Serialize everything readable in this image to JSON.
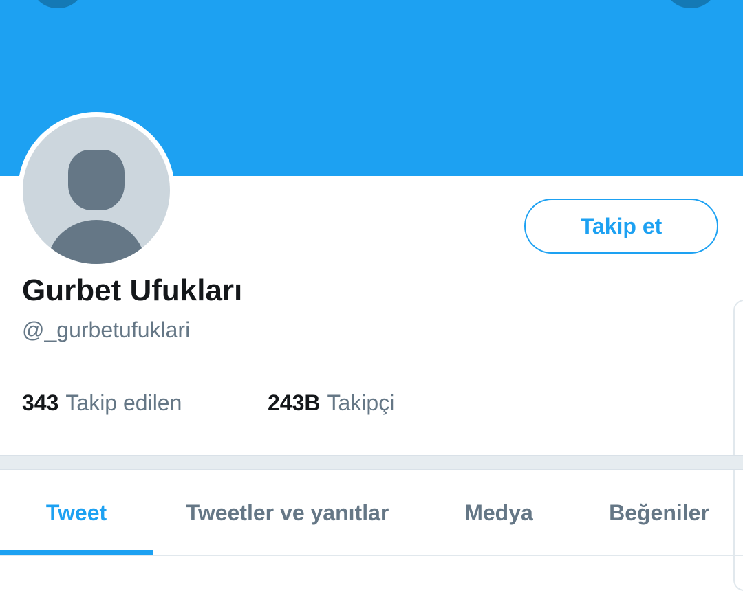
{
  "profile": {
    "display_name": "Gurbet Ufukları",
    "handle": "@_gurbetufuklari",
    "follow_button": "Takip et"
  },
  "stats": {
    "following": {
      "count": "343",
      "label": "Takip edilen"
    },
    "followers": {
      "count": "243B",
      "label": "Takipçi"
    }
  },
  "tabs": [
    {
      "label": "Tweet",
      "active": true
    },
    {
      "label": "Tweetler ve yanıtlar",
      "active": false
    },
    {
      "label": "Medya",
      "active": false
    },
    {
      "label": "Beğeniler",
      "active": false
    }
  ],
  "colors": {
    "accent": "#1da1f2",
    "text_primary": "#14171a",
    "text_secondary": "#657786",
    "avatar_bg": "#ccd6dd"
  },
  "icons": {
    "avatar": "default-avatar-icon"
  }
}
